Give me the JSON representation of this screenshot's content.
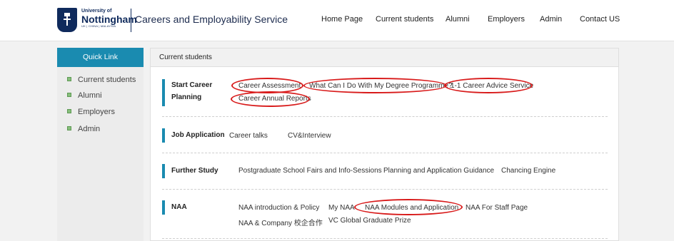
{
  "header": {
    "logo_small": "University of",
    "logo_big": "Nottingham",
    "logo_sub": "UK | CHINA | MALAYSIA",
    "site_title": "Careers and Employability Service",
    "nav": [
      "Home Page",
      "Current students",
      "Alumni",
      "Employers",
      "Admin",
      "Contact US"
    ]
  },
  "sidebar": {
    "title": "Quick Link",
    "items": [
      "Current students",
      "Alumni",
      "Employers",
      "Admin"
    ]
  },
  "content": {
    "heading": "Current students",
    "sections": [
      {
        "title_line1": "Start Career",
        "title_line2": "Planning",
        "links": [
          "Career Assessment",
          "What Can I Do With My Degree Programme?",
          "1-1 Career Advice Service",
          "Career Annual Reports"
        ]
      },
      {
        "title_line1": "Job Application",
        "links": [
          "Career talks",
          "CV&Interview"
        ]
      },
      {
        "title_line1": "Further Study",
        "links": [
          "Postgraduate School Fairs and Info-Sessions",
          "Planning and Application Guidance",
          "Chancing Engine"
        ]
      },
      {
        "title_line1": "NAA",
        "links": [
          "NAA introduction & Policy",
          "My NAA",
          "NAA Modules and Application",
          "NAA For Staff Page",
          "NAA & Company 校企合作",
          "VC Global Graduate Prize"
        ]
      }
    ]
  },
  "annotations": {
    "highlight_color": "#d81a1a"
  }
}
